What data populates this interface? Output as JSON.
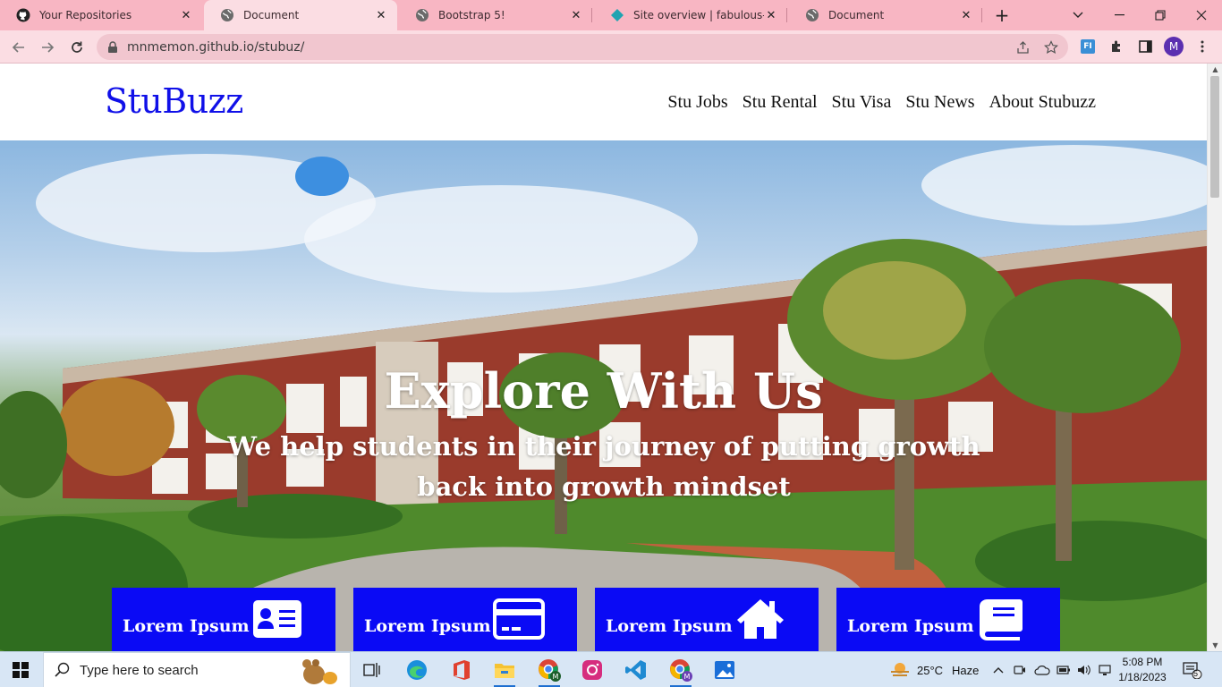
{
  "browser": {
    "tabs": [
      {
        "title": "Your Repositories",
        "icon": "github-icon",
        "active": false
      },
      {
        "title": "Document",
        "icon": "globe-icon",
        "active": true
      },
      {
        "title": "Bootstrap 5!",
        "icon": "globe-icon",
        "active": false
      },
      {
        "title": "Site overview | fabulous-cenc",
        "icon": "netlify-icon",
        "active": false
      },
      {
        "title": "Document",
        "icon": "globe-icon",
        "active": false
      }
    ],
    "url": "mnmemon.github.io/stubuz/",
    "profile_initial": "M",
    "extension_label": "FI"
  },
  "site": {
    "brand": "StuBuzz",
    "nav": [
      "Stu Jobs",
      "Stu Rental",
      "Stu Visa",
      "Stu News",
      "About Stubuzz"
    ],
    "hero": {
      "title": "Explore With Us",
      "subtitle": "We help students in their journey of putting growth back into growth mindset"
    },
    "cards": [
      {
        "label": "Lorem Ipsum",
        "icon": "id-card-icon"
      },
      {
        "label": "Lorem Ipsum",
        "icon": "credit-card-icon"
      },
      {
        "label": "Lorem Ipsum",
        "icon": "house-icon"
      },
      {
        "label": "Lorem Ipsum",
        "icon": "book-icon"
      }
    ],
    "colors": {
      "brand": "#1010e8",
      "card_bg": "#0a0af5"
    }
  },
  "taskbar": {
    "search_placeholder": "Type here to search",
    "apps": [
      "task-view-icon",
      "edge-icon",
      "office-icon",
      "file-explorer-icon",
      "chrome-profile-icon",
      "instagram-icon",
      "vscode-icon",
      "chrome-icon",
      "photos-icon"
    ],
    "weather": {
      "temp": "25°C",
      "condition": "Haze"
    },
    "time": "5:08 PM",
    "date": "1/18/2023",
    "notification_count": "5"
  }
}
